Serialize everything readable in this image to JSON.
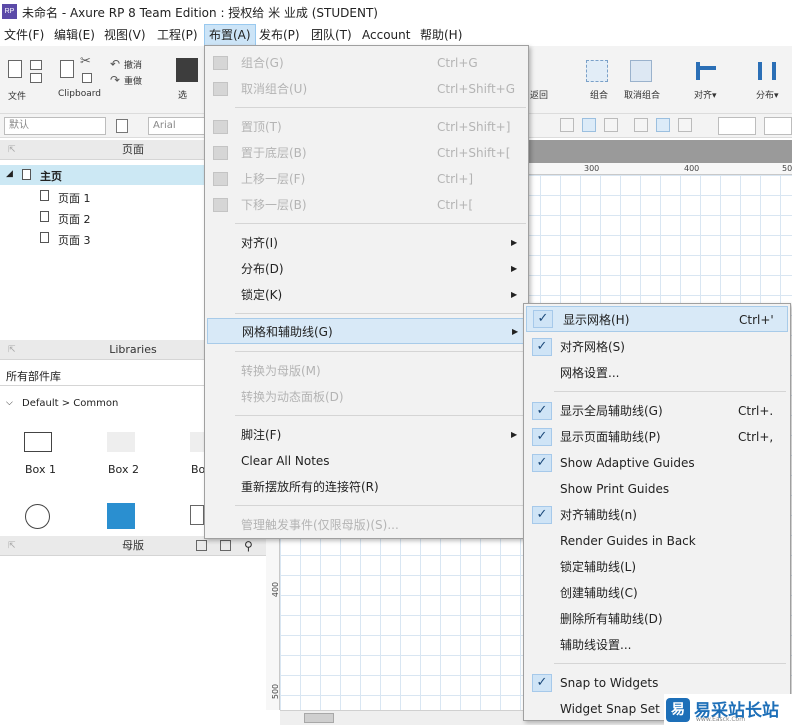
{
  "window": {
    "app_icon_text": "RP",
    "title": "未命名 - Axure RP 8 Team Edition : 授权给 米 业成 (STUDENT)"
  },
  "menubar": [
    {
      "label": "文件(F)"
    },
    {
      "label": "编辑(E)"
    },
    {
      "label": "视图(V)"
    },
    {
      "label": "工程(P)"
    },
    {
      "label": "布置(A)"
    },
    {
      "label": "发布(P)"
    },
    {
      "label": "团队(T)"
    },
    {
      "label": "Account"
    },
    {
      "label": "帮助(H)"
    }
  ],
  "ribbon": {
    "file_label": "文件",
    "clipboard_label": "Clipboard",
    "undo_label": "撤消",
    "redo_label": "重做",
    "select_label_partial": "选",
    "back_label_partial": "返回",
    "group_label": "组合",
    "ungroup_label": "取消组合",
    "align_label": "对齐▾",
    "distribute_label": "分布▾"
  },
  "formatbar": {
    "style_value": "默认",
    "font_value": "Arial"
  },
  "pages_panel": {
    "title": "页面",
    "root": "主页",
    "pages": [
      "页面 1",
      "页面 2",
      "页面 3"
    ]
  },
  "libraries_panel": {
    "title": "Libraries",
    "selected_library": "所有部件库",
    "group": "Default > Common",
    "widgets": [
      "Box 1",
      "Box 2",
      "Bo"
    ]
  },
  "masters_panel": {
    "title": "母版"
  },
  "rulers": {
    "top": [
      "300",
      "400",
      "50"
    ],
    "left": [
      "400",
      "500"
    ]
  },
  "arrange_menu": {
    "items": [
      {
        "label": "组合(G)",
        "shortcut": "Ctrl+G",
        "disabled": true
      },
      {
        "label": "取消组合(U)",
        "shortcut": "Ctrl+Shift+G",
        "disabled": true
      },
      {
        "label": "置顶(T)",
        "shortcut": "Ctrl+Shift+]",
        "disabled": true
      },
      {
        "label": "置于底层(B)",
        "shortcut": "Ctrl+Shift+[",
        "disabled": true
      },
      {
        "label": "上移一层(F)",
        "shortcut": "Ctrl+]",
        "disabled": true
      },
      {
        "label": "下移一层(B)",
        "shortcut": "Ctrl+[",
        "disabled": true
      },
      {
        "label": "对齐(I)",
        "submenu": true
      },
      {
        "label": "分布(D)",
        "submenu": true
      },
      {
        "label": "锁定(K)",
        "submenu": true
      },
      {
        "label": "网格和辅助线(G)",
        "submenu": true,
        "highlighted": true
      },
      {
        "label": "转换为母版(M)",
        "disabled": true
      },
      {
        "label": "转换为动态面板(D)",
        "disabled": true
      },
      {
        "label": "脚注(F)",
        "submenu": true
      },
      {
        "label": "Clear All Notes"
      },
      {
        "label": "重新摆放所有的连接符(R)"
      },
      {
        "label": "管理触发事件(仅限母版)(S)...",
        "disabled": true
      }
    ]
  },
  "grid_submenu": {
    "check_glyph": "✓",
    "items": [
      {
        "label": "显示网格(H)",
        "shortcut": "Ctrl+'",
        "checked": true,
        "highlighted": true
      },
      {
        "label": "对齐网格(S)",
        "checked": true
      },
      {
        "label": "网格设置..."
      },
      {
        "label": "显示全局辅助线(G)",
        "shortcut": "Ctrl+.",
        "checked": true
      },
      {
        "label": "显示页面辅助线(P)",
        "shortcut": "Ctrl+,",
        "checked": true
      },
      {
        "label": "Show Adaptive Guides",
        "checked": true
      },
      {
        "label": "Show Print Guides"
      },
      {
        "label": "对齐辅助线(n)",
        "checked": true
      },
      {
        "label": "Render Guides in Back"
      },
      {
        "label": "锁定辅助线(L)"
      },
      {
        "label": "创建辅助线(C)"
      },
      {
        "label": "删除所有辅助线(D)"
      },
      {
        "label": "辅助线设置..."
      },
      {
        "label": "Snap to Widgets",
        "checked": true
      },
      {
        "label": "Widget Snap Set"
      }
    ]
  },
  "watermark": {
    "badge": "易",
    "text": "易采站长站",
    "sub": "www.Easck.Com"
  }
}
